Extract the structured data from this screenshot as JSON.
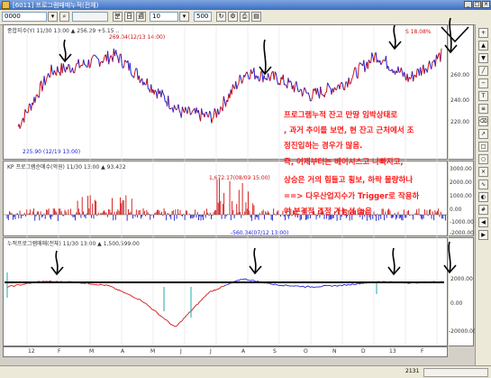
{
  "window": {
    "title": "[6011] 프로그램매매누적(전체)",
    "colors": {
      "title_bar": "#3a6ec4"
    }
  },
  "toolbar": {
    "code_value": "0000",
    "code_value2": "10",
    "count_value": "500",
    "period_label": "분"
  },
  "price_panel": {
    "header": "종합지수(Y) 11/30 13:00 ▲ 256.29 +5.15 ..",
    "high_label": "269.04(12/13 14:00)",
    "low_label": "225.90 (12/19 13:00)",
    "right_box": "S 18.08%",
    "yticks": [
      "260.00",
      "240.00",
      "220.00"
    ]
  },
  "program_panel": {
    "header": "KP 프로그램순매수(억원) 11/30 13:00 ▲ 93.432",
    "peak_label": "1,672.17(08/09 15:00)",
    "min_label": "-560.34(07/12 13:00)",
    "yticks": [
      "3000.00",
      "2000.00",
      "1000.00",
      "0.00",
      "-1000.00",
      "-2000.00"
    ]
  },
  "cumulative_panel": {
    "header": "누적프로그램매매(전체) 11/30 13:00 ▲ 1,500,599.00",
    "yticks": [
      "2000.00",
      "0.00",
      "-20000.00"
    ]
  },
  "annotation": {
    "lines": [
      "프로그램누적 잔고 만땅 임박상태로",
      ", 과거 추이를 보면, 현 잔고 근처에서 조",
      "정진입하는 경우가 많음.",
      "즉, 어제부터는 베이시스고 나빠지고,",
      "상승은 거의 힘들고 횡보, 하락 물량하나",
      "==> 다우산업지수가 Trigger로 작용하",
      "여 본격적 조정 가능성 높음"
    ],
    "color": "#ff1a1a"
  },
  "xaxis": {
    "labels": [
      "12",
      "F",
      "M",
      "A",
      "M",
      "J",
      "J",
      "A",
      "S",
      "O",
      "N",
      "D",
      "13",
      "F"
    ]
  },
  "statusbar": {
    "right_text": "2131"
  },
  "chart_data": {
    "type": "line",
    "note": "values estimated from screenshot",
    "x": [
      "12",
      "F",
      "M",
      "A",
      "M",
      "J",
      "J",
      "A",
      "S",
      "O",
      "N",
      "D",
      "13",
      "F"
    ],
    "series": [
      {
        "name": "price",
        "values": [
          232,
          255,
          258,
          262,
          250,
          238,
          236,
          255,
          252,
          245,
          250,
          262,
          252,
          262
        ]
      },
      {
        "name": "cumulative",
        "values": [
          0,
          2000,
          1800,
          500,
          -5000,
          -15000,
          -2000,
          3000,
          800,
          0,
          600,
          2000,
          1500,
          2000
        ]
      }
    ],
    "ylim": [
      220,
      270
    ]
  }
}
